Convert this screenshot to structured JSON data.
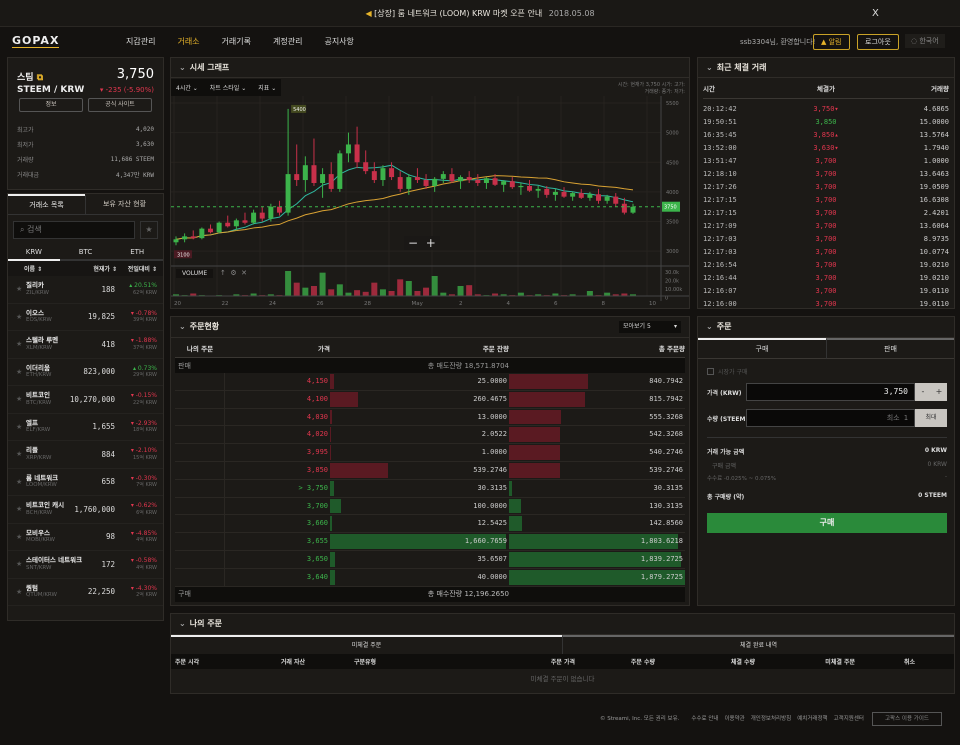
{
  "banner": {
    "text": "[상장] 룸 네트워크 (LOOM) KRW 마켓 오픈 안내",
    "date": "2018.05.08",
    "close": "X"
  },
  "header": {
    "logo": "GOPAX",
    "nav": [
      "지갑관리",
      "거래소",
      "거래기록",
      "계정관리",
      "공지사항"
    ],
    "active_nav": 1,
    "welcome": "ssb3304님, 환영합니다!",
    "alarm": "알림",
    "logout": "로그아웃",
    "language": "한국어"
  },
  "ticker": {
    "name": "스팀",
    "pair": "STEEM / KRW",
    "price": "3,750",
    "change": "▾ -235 (-5.90%)",
    "info_btn": "정보",
    "site_btn": "공식 사이트",
    "stats": [
      {
        "label": "최고가",
        "value": "4,020"
      },
      {
        "label": "최저가",
        "value": "3,630"
      },
      {
        "label": "거래량",
        "value": "11,686 STEEM"
      },
      {
        "label": "거래대금",
        "value": "4,347만 KRW"
      }
    ]
  },
  "market": {
    "tabs": [
      "거래소 목록",
      "보유 자산 현황"
    ],
    "search_placeholder": "검색",
    "bases": [
      "KRW",
      "BTC",
      "ETH"
    ],
    "cols": [
      "이름 ⇕",
      "현재가 ⇕",
      "전일대비 ⇕"
    ],
    "rows": [
      {
        "name": "질리카",
        "pair": "ZIL/KRW",
        "price": "188",
        "chg": "▴ 20.51%",
        "vol": "62억 KRW",
        "up": true
      },
      {
        "name": "이오스",
        "pair": "EOS/KRW",
        "price": "19,825",
        "chg": "▾ -0.78%",
        "vol": "39억 KRW",
        "up": false
      },
      {
        "name": "스텔라 루멘",
        "pair": "XLM/KRW",
        "price": "418",
        "chg": "▾ -1.88%",
        "vol": "37억 KRW",
        "up": false
      },
      {
        "name": "이더리움",
        "pair": "ETH/KRW",
        "price": "823,000",
        "chg": "▴ 0.73%",
        "vol": "29억 KRW",
        "up": true
      },
      {
        "name": "비트코인",
        "pair": "BTC/KRW",
        "price": "10,270,000",
        "chg": "▾ -0.15%",
        "vol": "22억 KRW",
        "up": false
      },
      {
        "name": "엘프",
        "pair": "ELF/KRW",
        "price": "1,655",
        "chg": "▾ -2.93%",
        "vol": "18억 KRW",
        "up": false
      },
      {
        "name": "리플",
        "pair": "XRP/KRW",
        "price": "884",
        "chg": "▾ -2.10%",
        "vol": "15억 KRW",
        "up": false
      },
      {
        "name": "룸 네트워크",
        "pair": "LOOM/KRW",
        "price": "658",
        "chg": "▾ -0.30%",
        "vol": "7억 KRW",
        "up": false
      },
      {
        "name": "비트코인 캐시",
        "pair": "BCH/KRW",
        "price": "1,760,000",
        "chg": "▾ -0.62%",
        "vol": "6억 KRW",
        "up": false
      },
      {
        "name": "모비우스",
        "pair": "MOBI/KRW",
        "price": "98",
        "chg": "▾ -4.85%",
        "vol": "4억 KRW",
        "up": false
      },
      {
        "name": "스테이터스 네트워크",
        "pair": "SNT/KRW",
        "price": "172",
        "chg": "▾ -0.58%",
        "vol": "4억 KRW",
        "up": false
      },
      {
        "name": "퀀텀",
        "pair": "QTUM/KRW",
        "price": "22,250",
        "chg": "▾ -4.30%",
        "vol": "2억 KRW",
        "up": false
      }
    ]
  },
  "chart": {
    "title": "시세 그래프",
    "controls": [
      "4시간",
      "차트 스타일",
      "지표"
    ],
    "legend": "시간: 현재가 3,750 시가: 고가: 거래량: 종가: 저가:",
    "zoom_out": "−",
    "zoom_in": "+",
    "volume_label": "VOLUME",
    "last_label": "3750",
    "high_label": "5400",
    "low_label": "3100"
  },
  "chart_data": {
    "type": "candlestick",
    "ylim": [
      2750,
      5550
    ],
    "yticks": [
      5500,
      5000,
      4500,
      4000,
      3500,
      3000
    ],
    "vol_ticks": [
      "30.0k",
      "20.0k",
      "10.00k",
      "0"
    ],
    "xticks": [
      "20",
      "22",
      "24",
      "26",
      "28",
      "May",
      "2",
      "4",
      "6",
      "8",
      "10"
    ],
    "candles": [
      [
        3150,
        3250,
        3100,
        3200
      ],
      [
        3200,
        3300,
        3150,
        3250
      ],
      [
        3250,
        3350,
        3200,
        3220
      ],
      [
        3220,
        3400,
        3200,
        3380
      ],
      [
        3380,
        3450,
        3300,
        3320
      ],
      [
        3320,
        3500,
        3300,
        3480
      ],
      [
        3480,
        3600,
        3400,
        3420
      ],
      [
        3420,
        3550,
        3350,
        3520
      ],
      [
        3520,
        3650,
        3450,
        3480
      ],
      [
        3480,
        3700,
        3450,
        3650
      ],
      [
        3650,
        3750,
        3500,
        3550
      ],
      [
        3550,
        3800,
        3500,
        3750
      ],
      [
        3750,
        3850,
        3600,
        3650
      ],
      [
        3650,
        5400,
        3600,
        4300
      ],
      [
        4300,
        4800,
        4100,
        4200
      ],
      [
        4200,
        4600,
        4000,
        4450
      ],
      [
        4450,
        4900,
        4100,
        4150
      ],
      [
        4150,
        4400,
        3900,
        4300
      ],
      [
        4300,
        4500,
        4000,
        4050
      ],
      [
        4050,
        4700,
        4000,
        4650
      ],
      [
        4650,
        5000,
        4500,
        4800
      ],
      [
        4800,
        5100,
        4400,
        4500
      ],
      [
        4500,
        4700,
        4300,
        4350
      ],
      [
        4350,
        4500,
        4150,
        4200
      ],
      [
        4200,
        4450,
        4100,
        4400
      ],
      [
        4400,
        4500,
        4200,
        4250
      ],
      [
        4250,
        4350,
        4000,
        4050
      ],
      [
        4050,
        4300,
        3950,
        4250
      ],
      [
        4250,
        4400,
        4150,
        4200
      ],
      [
        4200,
        4300,
        4050,
        4100
      ],
      [
        4100,
        4250,
        4000,
        4220
      ],
      [
        4220,
        4350,
        4150,
        4300
      ],
      [
        4300,
        4400,
        4150,
        4180
      ],
      [
        4180,
        4280,
        4050,
        4250
      ],
      [
        4250,
        4350,
        4150,
        4200
      ],
      [
        4200,
        4300,
        4100,
        4150
      ],
      [
        4150,
        4250,
        4050,
        4230
      ],
      [
        4230,
        4300,
        4100,
        4120
      ],
      [
        4120,
        4200,
        4000,
        4180
      ],
      [
        4180,
        4250,
        4050,
        4080
      ],
      [
        4080,
        4150,
        3950,
        4100
      ],
      [
        4100,
        4200,
        4000,
        4020
      ],
      [
        4020,
        4100,
        3900,
        4050
      ],
      [
        4050,
        4100,
        3900,
        3950
      ],
      [
        3950,
        4050,
        3850,
        4000
      ],
      [
        4000,
        4080,
        3900,
        3920
      ],
      [
        3920,
        4000,
        3850,
        3980
      ],
      [
        3980,
        4050,
        3880,
        3900
      ],
      [
        3900,
        4000,
        3850,
        3960
      ],
      [
        3960,
        4050,
        3800,
        3850
      ],
      [
        3850,
        3950,
        3800,
        3920
      ],
      [
        3920,
        3980,
        3750,
        3800
      ],
      [
        3800,
        3900,
        3620,
        3650
      ],
      [
        3650,
        3800,
        3630,
        3750
      ]
    ],
    "volume": [
      2,
      1,
      3,
      1,
      0.5,
      1,
      0.5,
      2,
      1,
      3,
      1,
      2,
      1,
      30,
      16,
      10,
      12,
      28,
      8,
      14,
      4,
      7,
      5,
      16,
      8,
      6,
      20,
      18,
      6,
      10,
      24,
      4,
      2,
      12,
      13,
      2,
      1,
      3,
      2,
      1,
      4,
      1,
      2,
      1,
      3,
      1,
      2,
      0.5,
      6,
      1,
      4,
      2,
      3,
      2
    ],
    "colors": {
      "up": "#3cb44b",
      "down": "#c8304a",
      "ma_short": "#2fb8a0",
      "ma_long": "#d9a233"
    }
  },
  "trades": {
    "title": "최근 체결 거래",
    "cols": [
      "시간",
      "체결가",
      "거래량"
    ],
    "rows": [
      [
        "20:12:42",
        "3,750▾",
        "4.6865",
        "r"
      ],
      [
        "19:50:51",
        "3,850",
        "15.0000",
        "g"
      ],
      [
        "16:35:45",
        "3,850▴",
        "13.5764",
        "r"
      ],
      [
        "13:52:00",
        "3,630▾",
        "1.7940",
        "r"
      ],
      [
        "13:51:47",
        "3,700",
        "1.0000",
        "r"
      ],
      [
        "12:18:10",
        "3,700",
        "13.6463",
        "r"
      ],
      [
        "12:17:26",
        "3,700",
        "19.0509",
        "r"
      ],
      [
        "12:17:15",
        "3,700",
        "16.6308",
        "r"
      ],
      [
        "12:17:15",
        "3,700",
        "2.4201",
        "r"
      ],
      [
        "12:17:09",
        "3,700",
        "13.6064",
        "r"
      ],
      [
        "12:17:03",
        "3,700",
        "8.9735",
        "r"
      ],
      [
        "12:17:03",
        "3,700",
        "10.0774",
        "r"
      ],
      [
        "12:16:54",
        "3,700",
        "19.0210",
        "r"
      ],
      [
        "12:16:44",
        "3,700",
        "19.0210",
        "r"
      ],
      [
        "12:16:07",
        "3,700",
        "19.0110",
        "r"
      ],
      [
        "12:16:00",
        "3,700",
        "19.0110",
        "r"
      ]
    ]
  },
  "orderbook": {
    "title": "주문현황",
    "view": "모아보기 5",
    "cols": [
      "나의 주문",
      "가격",
      "주문 잔량",
      "총 주문량"
    ],
    "sell_label": "판매",
    "sell_total_label": "총 매도잔량",
    "sell_total": "18,571.8704",
    "buy_label": "구매",
    "buy_total_label": "총 매수잔량",
    "buy_total": "12,196.2650",
    "asks": [
      [
        "4,150",
        "25.0000",
        "840.7942"
      ],
      [
        "4,100",
        "260.4675",
        "815.7942"
      ],
      [
        "4,030",
        "13.0000",
        "555.3268"
      ],
      [
        "4,020",
        "2.0522",
        "542.3268"
      ],
      [
        "3,995",
        "1.0000",
        "540.2746"
      ],
      [
        "3,850",
        "539.2746",
        "539.2746"
      ]
    ],
    "bids": [
      [
        "> 3,750",
        "30.3135",
        "30.3135"
      ],
      [
        "3,700",
        "100.0000",
        "130.3135"
      ],
      [
        "3,660",
        "12.5425",
        "142.8560"
      ],
      [
        "3,655",
        "1,660.7659",
        "1,803.6218"
      ],
      [
        "3,650",
        "35.6507",
        "1,839.2725"
      ],
      [
        "3,640",
        "40.0000",
        "1,879.2725"
      ]
    ]
  },
  "order": {
    "title": "주문",
    "tabs": [
      "구매",
      "판매"
    ],
    "market_order": "시장가 구매",
    "price_label": "가격 (KRW)",
    "price_value": "3,750",
    "minus": "-",
    "plus": "+",
    "qty_label": "수량 (STEEM)",
    "qty_placeholder": "최소 1",
    "max": "최대",
    "available_label": "거래 가능 금액",
    "available": "0 KRW",
    "buy_amount_label": "구매 금액",
    "buy_amount": "0 KRW",
    "fee_label": "수수료 -0.025% ~ 0.075%",
    "fee": "-",
    "total_label": "총 구매량 (약)",
    "total": "0 STEEM",
    "submit": "구매"
  },
  "myorders": {
    "title": "나의 주문",
    "tabs": [
      "미체결 주문",
      "체결 완료 내역"
    ],
    "cols": [
      "주문 시각",
      "거래 자산",
      "구분",
      "유형",
      "주문 가격",
      "주문 수량",
      "체결 수량",
      "미체결 주문",
      "취소"
    ],
    "empty": "미체결 주문이 없습니다"
  },
  "footer": {
    "copyright": "© Streami, Inc. 모든 권리 보유.",
    "links": [
      "수수료 안내",
      "이용약관",
      "개인정보처리방침",
      "예치거래정책",
      "고객지원센터"
    ],
    "guide": "고팍스 이용 가이드"
  }
}
